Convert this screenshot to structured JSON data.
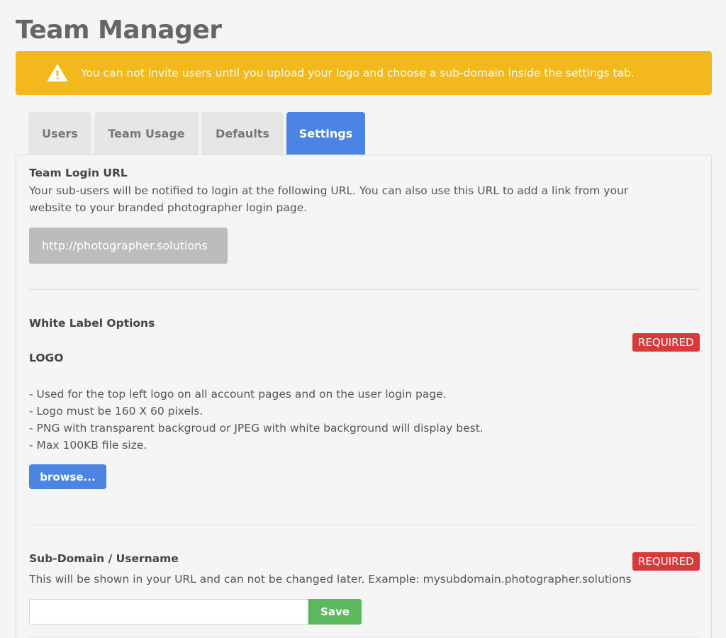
{
  "header": {
    "title": "Team Manager"
  },
  "alert": {
    "text": "You can not invite users until you upload your logo and choose a sub-domain inside the settings tab.",
    "color": "#f2b81c",
    "icon": "warning-triangle-icon"
  },
  "tabs": [
    {
      "label": "Users",
      "active": false
    },
    {
      "label": "Team Usage",
      "active": false
    },
    {
      "label": "Defaults",
      "active": false
    },
    {
      "label": "Settings",
      "active": true
    }
  ],
  "login_url_section": {
    "heading": "Team Login URL",
    "description_line1": "Your sub-users will be notified to login at the following URL. You can also use this URL to add a link from your",
    "description_line2": "website to your branded photographer login page.",
    "url": "http://photographer.solutions"
  },
  "white_label_section": {
    "heading": "White Label Options",
    "logo_label": "LOGO",
    "required_badge": "REQUIRED",
    "notes": [
      "- Used for the top left logo on all account pages and on the user login page.",
      "- Logo must be 160 X 60 pixels.",
      "- PNG with transparent backgroud or JPEG with white background will display best.",
      "- Max 100KB file size."
    ],
    "browse_label": "browse..."
  },
  "subdomain_section": {
    "heading": "Sub-Domain / Username",
    "required_badge": "REQUIRED",
    "description": "This will be shown in your URL and can not be changed later. Example: mysubdomain.photographer.solutions",
    "input_value": "",
    "save_label": "Save"
  },
  "colors": {
    "accent_blue": "#4b84e3",
    "required_red": "#d83a3a",
    "save_green": "#5cb85c"
  }
}
